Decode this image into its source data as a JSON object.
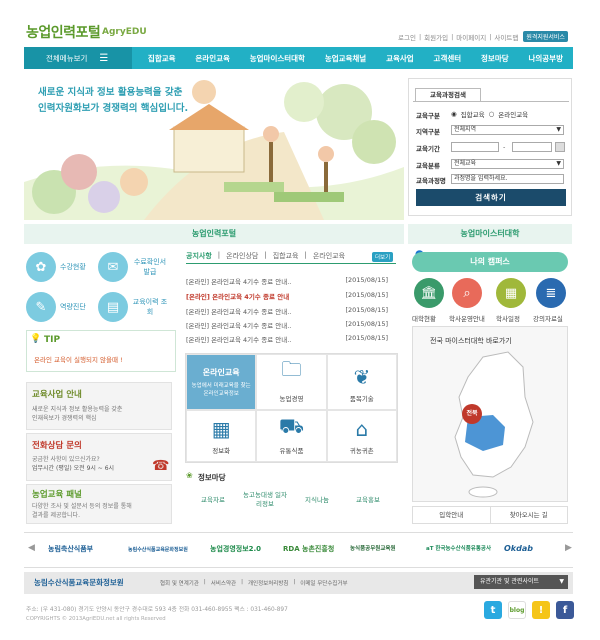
{
  "header": {
    "logo": "농업인력포털",
    "logo_sub": "AgryEDU",
    "util": [
      "로그인",
      "회원가입",
      "마이페이지",
      "사이트맵"
    ],
    "remote_support": "원격지원서비스"
  },
  "gnb": {
    "all_menu": "전체메뉴보기",
    "items": [
      "집합교육",
      "온라인교육",
      "농업마이스터대학",
      "농업교육채널",
      "교육사업",
      "고객센터",
      "정보마당",
      "나의공부방"
    ]
  },
  "hero": {
    "line1": "새로운 지식과 정보 활용능력을 갖춘",
    "line2": "인력자원화보가 경쟁력의 핵심입니다."
  },
  "search": {
    "tab": "교육과정검색",
    "type_label": "교육구분",
    "type_opt1": "집합교육",
    "type_opt2": "온라인교육",
    "region_label": "지역구분",
    "region_value": "전체지역",
    "period_label": "교육기간",
    "period_sep": "-",
    "category_label": "교육분류",
    "category_value": "전체교육",
    "course_label": "교육과정명",
    "course_placeholder": "과정명을 입력하세요.",
    "button": "검색하기"
  },
  "left": {
    "title": "농업인력포털",
    "quick": [
      "수강현황",
      "수료확인서 발급",
      "역량진단",
      "교육이력 조회"
    ],
    "tip_title": "TIP",
    "tip_body": "온라인 교육이 실행되지 않을때 !",
    "boxes": [
      {
        "title": "교육사업 안내",
        "body1": "새로운 지식과 정보 활용능력을 갖춘",
        "body2": "인재육보가 경쟁력의 핵심"
      },
      {
        "title": "전화상담 문의",
        "body1": "궁금한 사항이 있으신가요?",
        "body2": "업무시간 (평일) 오전 9시 ~ 6시"
      },
      {
        "title": "농업교육 패널",
        "body1": "다양한 조사 및 설문서 등의 정보를 통해",
        "body2": "결과를 제공합니다."
      }
    ]
  },
  "notice": {
    "tabs": [
      "공지사항",
      "온라인상담",
      "집합교육",
      "온라인교육"
    ],
    "more": "더보기",
    "items": [
      {
        "title": "[온라인] 온라인교육 4기수 종료 안내..",
        "date": "[2015/08/15]"
      },
      {
        "title": "[온라인] 온라인교육 4기수 종료 안내",
        "date": "[2015/08/15]"
      },
      {
        "title": "[온라인] 온라인교육 4기수 종료 안내..",
        "date": "[2015/08/15]"
      },
      {
        "title": "[온라인] 온라인교육 4기수 종료 안내..",
        "date": "[2015/08/15]"
      },
      {
        "title": "[온라인] 온라인교육 4기수 종료 안내..",
        "date": "[2015/08/15]"
      }
    ]
  },
  "services": {
    "feature_title": "온라인교육",
    "feature_body": "농업에서 미래교육을 찾는 온라인교육정보",
    "items": [
      "농업경영",
      "품목기술",
      "정보화",
      "유통식품",
      "귀농귀촌"
    ]
  },
  "jeongbo": {
    "title": "정보마당",
    "items": [
      "교육자료",
      "농고농대생 일자리정보",
      "지식나눔",
      "교육홍보"
    ]
  },
  "right": {
    "title": "농업마이스터대학",
    "campus": "나의 캠퍼스",
    "icons": [
      "대학현황",
      "학사운영안내",
      "학사일정",
      "강의자료실"
    ],
    "map_title": "전국 마이스터대학 바로가기",
    "map_marker": "전북",
    "btn_admission": "입학안내",
    "btn_location": "찾아오시는 길"
  },
  "partners": [
    "농림축산식품부",
    "농림수산식품교육문화정보원",
    "농업경영정보2.0",
    "RDA 농촌진흥청",
    "농식품공무원교육원",
    "aT 한국농수산식품유통공사",
    "Okdab"
  ],
  "footer": {
    "logo": "농림수산식품교육문화정보원",
    "links": [
      "협회 및 연계기관",
      "서비스약관",
      "개인정보처리방침",
      "이메일 무단수집거부"
    ],
    "related": "유관기관 및 관련사이트",
    "address": "주소: (우 431-080) 경기도 안양시 동안구 경수대로 593 4층   전화 031-460-8955 팩스 : 031-460-897",
    "copyright": "COPYRIGHTS © 2013AgriEDU.net all rights Reserved",
    "sns": [
      "twitter-icon",
      "blog-icon",
      "kakao-icon",
      "facebook-icon"
    ]
  },
  "colors": {
    "brand_green": "#5b9a2b",
    "gnb_teal": "#22b0c5",
    "search_navy": "#1b4b6b",
    "accent_red": "#c0392b"
  }
}
